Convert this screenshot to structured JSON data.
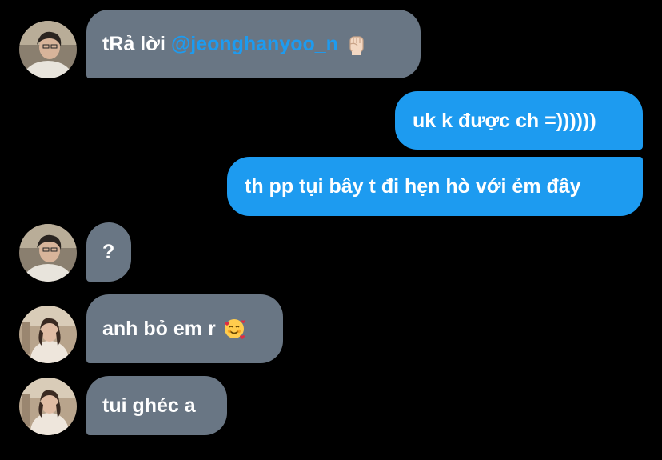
{
  "conversation": {
    "messages": [
      {
        "sender": "other-a",
        "direction": "incoming",
        "prefix": "tRả lời ",
        "mention": "@jeonghanyoo_n",
        "emoji": "raised-fist-icon"
      },
      {
        "sender": "me",
        "direction": "outgoing",
        "text": "uk k được ch =))))))"
      },
      {
        "sender": "me",
        "direction": "outgoing",
        "text": "th pp tụi bây t đi hẹn hò với ẻm đây"
      },
      {
        "sender": "other-a",
        "direction": "incoming",
        "text": "?"
      },
      {
        "sender": "other-b",
        "direction": "incoming",
        "text": "anh bỏ em r",
        "emoji": "smiling-face-with-hearts-icon"
      },
      {
        "sender": "other-b",
        "direction": "incoming",
        "text": "tui ghéc a"
      }
    ]
  },
  "colors": {
    "background": "#000000",
    "incoming_bubble": "#697684",
    "outgoing_bubble": "#1d9bf0",
    "mention": "#1d9bf0",
    "text": "#ffffff"
  }
}
